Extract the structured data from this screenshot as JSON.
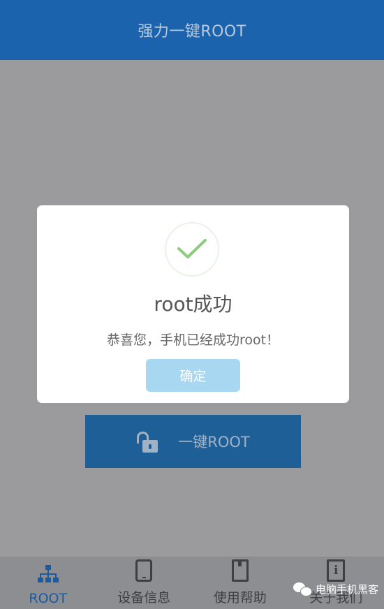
{
  "app": {
    "title": "强力一键ROOT"
  },
  "root_action": {
    "label": "一键ROOT",
    "icon": "unlock-icon"
  },
  "dialog": {
    "icon": "checkmark-circle-icon",
    "title": "root成功",
    "message": "恭喜您，手机已经成功root！",
    "confirm_label": "确定"
  },
  "bottom_nav": {
    "items": [
      {
        "label": "ROOT",
        "icon": "sitemap-icon",
        "active": true
      },
      {
        "label": "设备信息",
        "icon": "device-icon",
        "active": false
      },
      {
        "label": "使用帮助",
        "icon": "book-icon",
        "active": false
      },
      {
        "label": "关于我们",
        "icon": "info-icon",
        "active": false
      }
    ]
  },
  "watermark": {
    "text": "电脑手机黑客"
  },
  "colors": {
    "appbar": "#1b63ad",
    "overlay": "#9b9b9d",
    "active_tab": "#1c5aa0",
    "check_green": "#8dcc7f",
    "confirm_button": "#a8d8f1"
  }
}
